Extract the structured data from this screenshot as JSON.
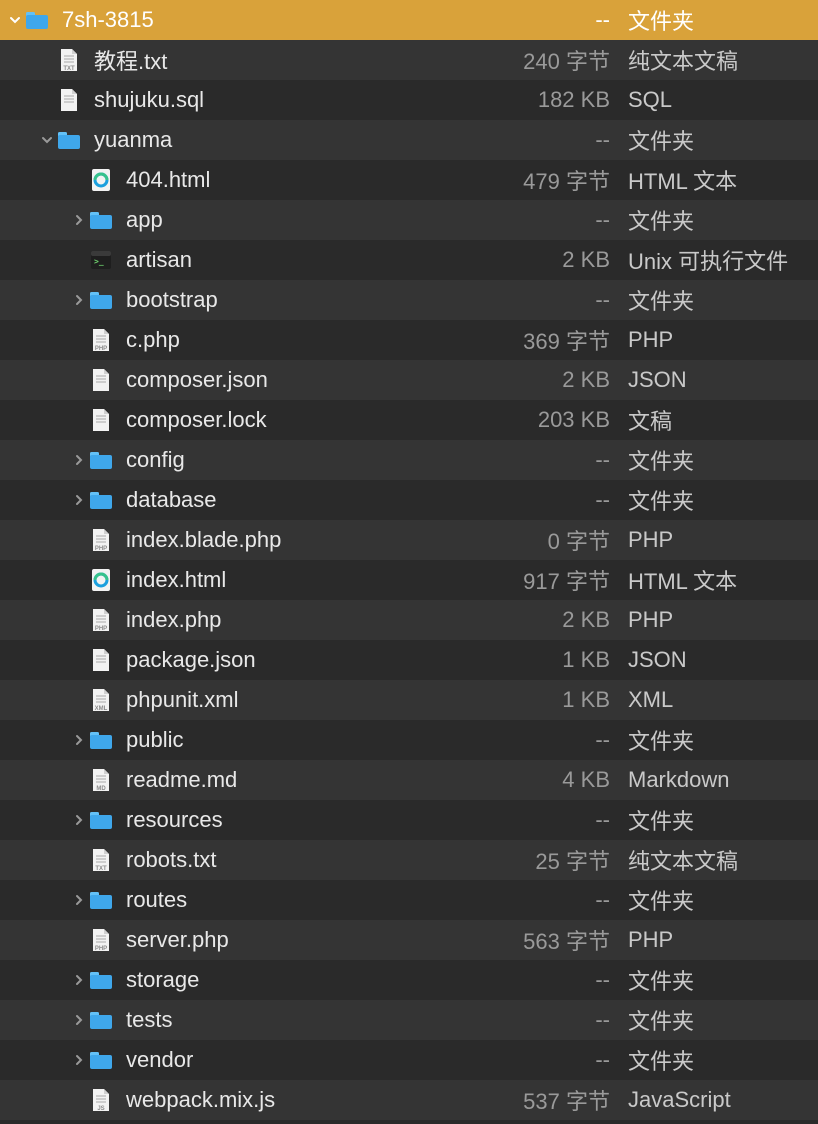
{
  "rows": [
    {
      "indent": 0,
      "disclosure": "open",
      "icon": "folder",
      "name": "7sh-3815",
      "size": "--",
      "kind": "文件夹",
      "selected": true,
      "alt": false
    },
    {
      "indent": 1,
      "disclosure": "none",
      "icon": "txt",
      "name": "教程.txt",
      "size": "240 字节",
      "kind": "纯文本文稿",
      "selected": false,
      "alt": true
    },
    {
      "indent": 1,
      "disclosure": "none",
      "icon": "doc",
      "name": "shujuku.sql",
      "size": "182 KB",
      "kind": "SQL",
      "selected": false,
      "alt": false
    },
    {
      "indent": 1,
      "disclosure": "open",
      "icon": "folder",
      "name": "yuanma",
      "size": "--",
      "kind": "文件夹",
      "selected": false,
      "alt": true
    },
    {
      "indent": 2,
      "disclosure": "none",
      "icon": "edge",
      "name": "404.html",
      "size": "479 字节",
      "kind": "HTML 文本",
      "selected": false,
      "alt": false
    },
    {
      "indent": 2,
      "disclosure": "closed",
      "icon": "folder",
      "name": "app",
      "size": "--",
      "kind": "文件夹",
      "selected": false,
      "alt": true
    },
    {
      "indent": 2,
      "disclosure": "none",
      "icon": "exec",
      "name": "artisan",
      "size": "2 KB",
      "kind": "Unix 可执行文件",
      "selected": false,
      "alt": false
    },
    {
      "indent": 2,
      "disclosure": "closed",
      "icon": "folder",
      "name": "bootstrap",
      "size": "--",
      "kind": "文件夹",
      "selected": false,
      "alt": true
    },
    {
      "indent": 2,
      "disclosure": "none",
      "icon": "php",
      "name": "c.php",
      "size": "369 字节",
      "kind": "PHP",
      "selected": false,
      "alt": false
    },
    {
      "indent": 2,
      "disclosure": "none",
      "icon": "doc",
      "name": "composer.json",
      "size": "2 KB",
      "kind": "JSON",
      "selected": false,
      "alt": true
    },
    {
      "indent": 2,
      "disclosure": "none",
      "icon": "doc",
      "name": "composer.lock",
      "size": "203 KB",
      "kind": "文稿",
      "selected": false,
      "alt": false
    },
    {
      "indent": 2,
      "disclosure": "closed",
      "icon": "folder",
      "name": "config",
      "size": "--",
      "kind": "文件夹",
      "selected": false,
      "alt": true
    },
    {
      "indent": 2,
      "disclosure": "closed",
      "icon": "folder",
      "name": "database",
      "size": "--",
      "kind": "文件夹",
      "selected": false,
      "alt": false
    },
    {
      "indent": 2,
      "disclosure": "none",
      "icon": "php",
      "name": "index.blade.php",
      "size": "0 字节",
      "kind": "PHP",
      "selected": false,
      "alt": true
    },
    {
      "indent": 2,
      "disclosure": "none",
      "icon": "edge",
      "name": "index.html",
      "size": "917 字节",
      "kind": "HTML 文本",
      "selected": false,
      "alt": false
    },
    {
      "indent": 2,
      "disclosure": "none",
      "icon": "php",
      "name": "index.php",
      "size": "2 KB",
      "kind": "PHP",
      "selected": false,
      "alt": true
    },
    {
      "indent": 2,
      "disclosure": "none",
      "icon": "doc",
      "name": "package.json",
      "size": "1 KB",
      "kind": "JSON",
      "selected": false,
      "alt": false
    },
    {
      "indent": 2,
      "disclosure": "none",
      "icon": "xml",
      "name": "phpunit.xml",
      "size": "1 KB",
      "kind": "XML",
      "selected": false,
      "alt": true
    },
    {
      "indent": 2,
      "disclosure": "closed",
      "icon": "folder",
      "name": "public",
      "size": "--",
      "kind": "文件夹",
      "selected": false,
      "alt": false
    },
    {
      "indent": 2,
      "disclosure": "none",
      "icon": "md",
      "name": "readme.md",
      "size": "4 KB",
      "kind": "Markdown",
      "selected": false,
      "alt": true
    },
    {
      "indent": 2,
      "disclosure": "closed",
      "icon": "folder",
      "name": "resources",
      "size": "--",
      "kind": "文件夹",
      "selected": false,
      "alt": false
    },
    {
      "indent": 2,
      "disclosure": "none",
      "icon": "txt",
      "name": "robots.txt",
      "size": "25 字节",
      "kind": "纯文本文稿",
      "selected": false,
      "alt": true
    },
    {
      "indent": 2,
      "disclosure": "closed",
      "icon": "folder",
      "name": "routes",
      "size": "--",
      "kind": "文件夹",
      "selected": false,
      "alt": false
    },
    {
      "indent": 2,
      "disclosure": "none",
      "icon": "php",
      "name": "server.php",
      "size": "563 字节",
      "kind": "PHP",
      "selected": false,
      "alt": true
    },
    {
      "indent": 2,
      "disclosure": "closed",
      "icon": "folder",
      "name": "storage",
      "size": "--",
      "kind": "文件夹",
      "selected": false,
      "alt": false
    },
    {
      "indent": 2,
      "disclosure": "closed",
      "icon": "folder",
      "name": "tests",
      "size": "--",
      "kind": "文件夹",
      "selected": false,
      "alt": true
    },
    {
      "indent": 2,
      "disclosure": "closed",
      "icon": "folder",
      "name": "vendor",
      "size": "--",
      "kind": "文件夹",
      "selected": false,
      "alt": false
    },
    {
      "indent": 2,
      "disclosure": "none",
      "icon": "js",
      "name": "webpack.mix.js",
      "size": "537 字节",
      "kind": "JavaScript",
      "selected": false,
      "alt": true
    }
  ]
}
